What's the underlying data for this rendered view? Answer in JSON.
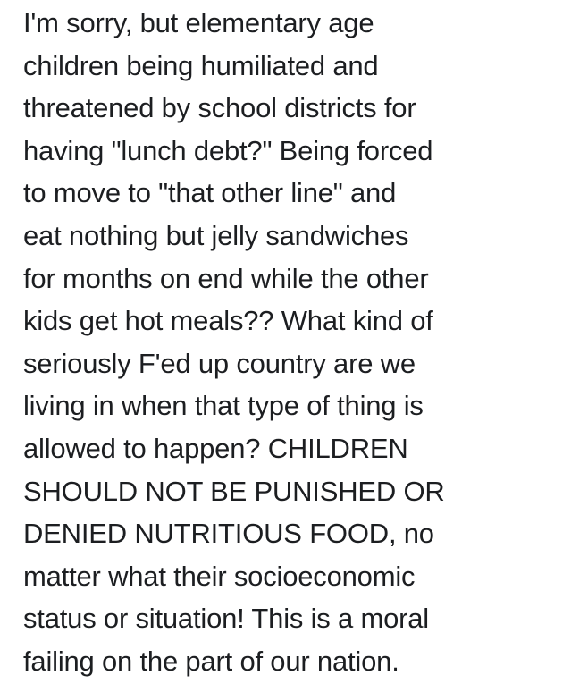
{
  "post": {
    "lines": [
      "I'm sorry, but elementary age",
      "children being humiliated and",
      "threatened by school districts for",
      "having \"lunch debt?\"  Being forced",
      "to move to \"that other line\" and",
      "eat nothing but jelly sandwiches",
      "for months on end while the other",
      "kids get hot meals??  What kind of",
      "seriously F'ed up country are we",
      "living in when that type of thing is",
      "allowed to happen?  CHILDREN",
      "SHOULD NOT BE PUNISHED OR",
      "DENIED NUTRITIOUS FOOD, no",
      "matter what their socioeconomic",
      "status or situation!  This is a moral",
      "failing on the part of our nation."
    ]
  }
}
